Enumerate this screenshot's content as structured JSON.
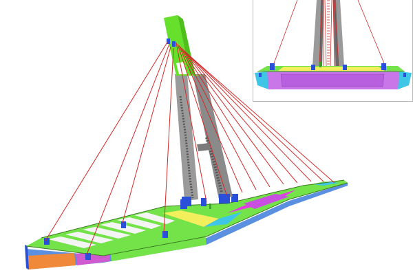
{
  "colors": {
    "background": "#ffffff",
    "pylon_top": "#66e02a",
    "pylon_legs": "#9a9a9a",
    "pylon_dark": "#6b6b6b",
    "cables": "#d42828",
    "deck_green": "#74e34a",
    "deck_yellow": "#f2ee5c",
    "deck_magenta": "#e63ce6",
    "deck_cyan": "#3fc6e6",
    "deck_orange": "#f08a3a",
    "deck_blue": "#2a4fd8",
    "deck_white": "#f4f4f4",
    "inset_violet": "#c876e8",
    "inset_border": "#b8b8b8"
  },
  "main_view": {
    "deck_segments": [
      "green",
      "white",
      "yellow",
      "cyan",
      "magenta",
      "green"
    ],
    "cable_count": 14
  },
  "inset_view": {
    "cable_count": 10
  }
}
